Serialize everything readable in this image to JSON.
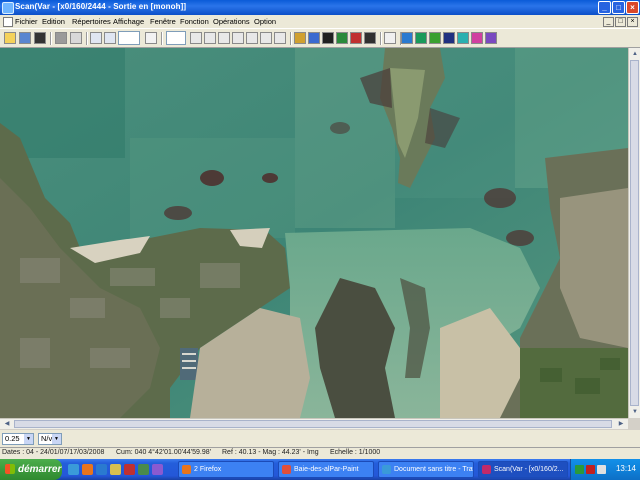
{
  "window": {
    "title": "Scan(Var - [x0/160/2444 - Sortie en [monoh]]",
    "controls": [
      "_",
      "□",
      "×"
    ]
  },
  "menu": {
    "items": [
      "Fichier",
      "Edition",
      "Répertoires",
      "Affichage",
      "Fenêtre",
      "Fonction",
      "Opérations",
      "Option"
    ],
    "doc_controls": [
      "_",
      "□",
      "×"
    ]
  },
  "map": {
    "description_icon": "aerial-photo",
    "colors": {
      "sea": "#3f8a7a",
      "shallow": "#6fa890",
      "sand": "#c9c2a6",
      "land": "#5a6a48",
      "rock": "#4a3a3a",
      "urban": "#8a8878"
    }
  },
  "scale": {
    "zoom_value": "0.25",
    "unit_value": "N/v"
  },
  "status": {
    "date": "Dates : 04 - 24/01/07/17/03/2008",
    "coords": "Cum: 040 4°42'01.00'44'59.98'",
    "ref": "Ref : 40.13 - Mag : 44.23' - Img",
    "scale": "Echelle : 1/1000"
  },
  "taskbar": {
    "start_label": "démarrer",
    "tasks": [
      {
        "label": "2 Firefox",
        "color": "#e8741c"
      },
      {
        "label": "Baie-des-alPar-Paint",
        "color": "#e04f3a"
      },
      {
        "label": "Document sans titre - Trav...",
        "color": "#3a9ad9"
      },
      {
        "label": "Scan(Var - [x0/160/2...",
        "color": "#c02a6a",
        "active": true
      }
    ],
    "clock": "13:14"
  }
}
